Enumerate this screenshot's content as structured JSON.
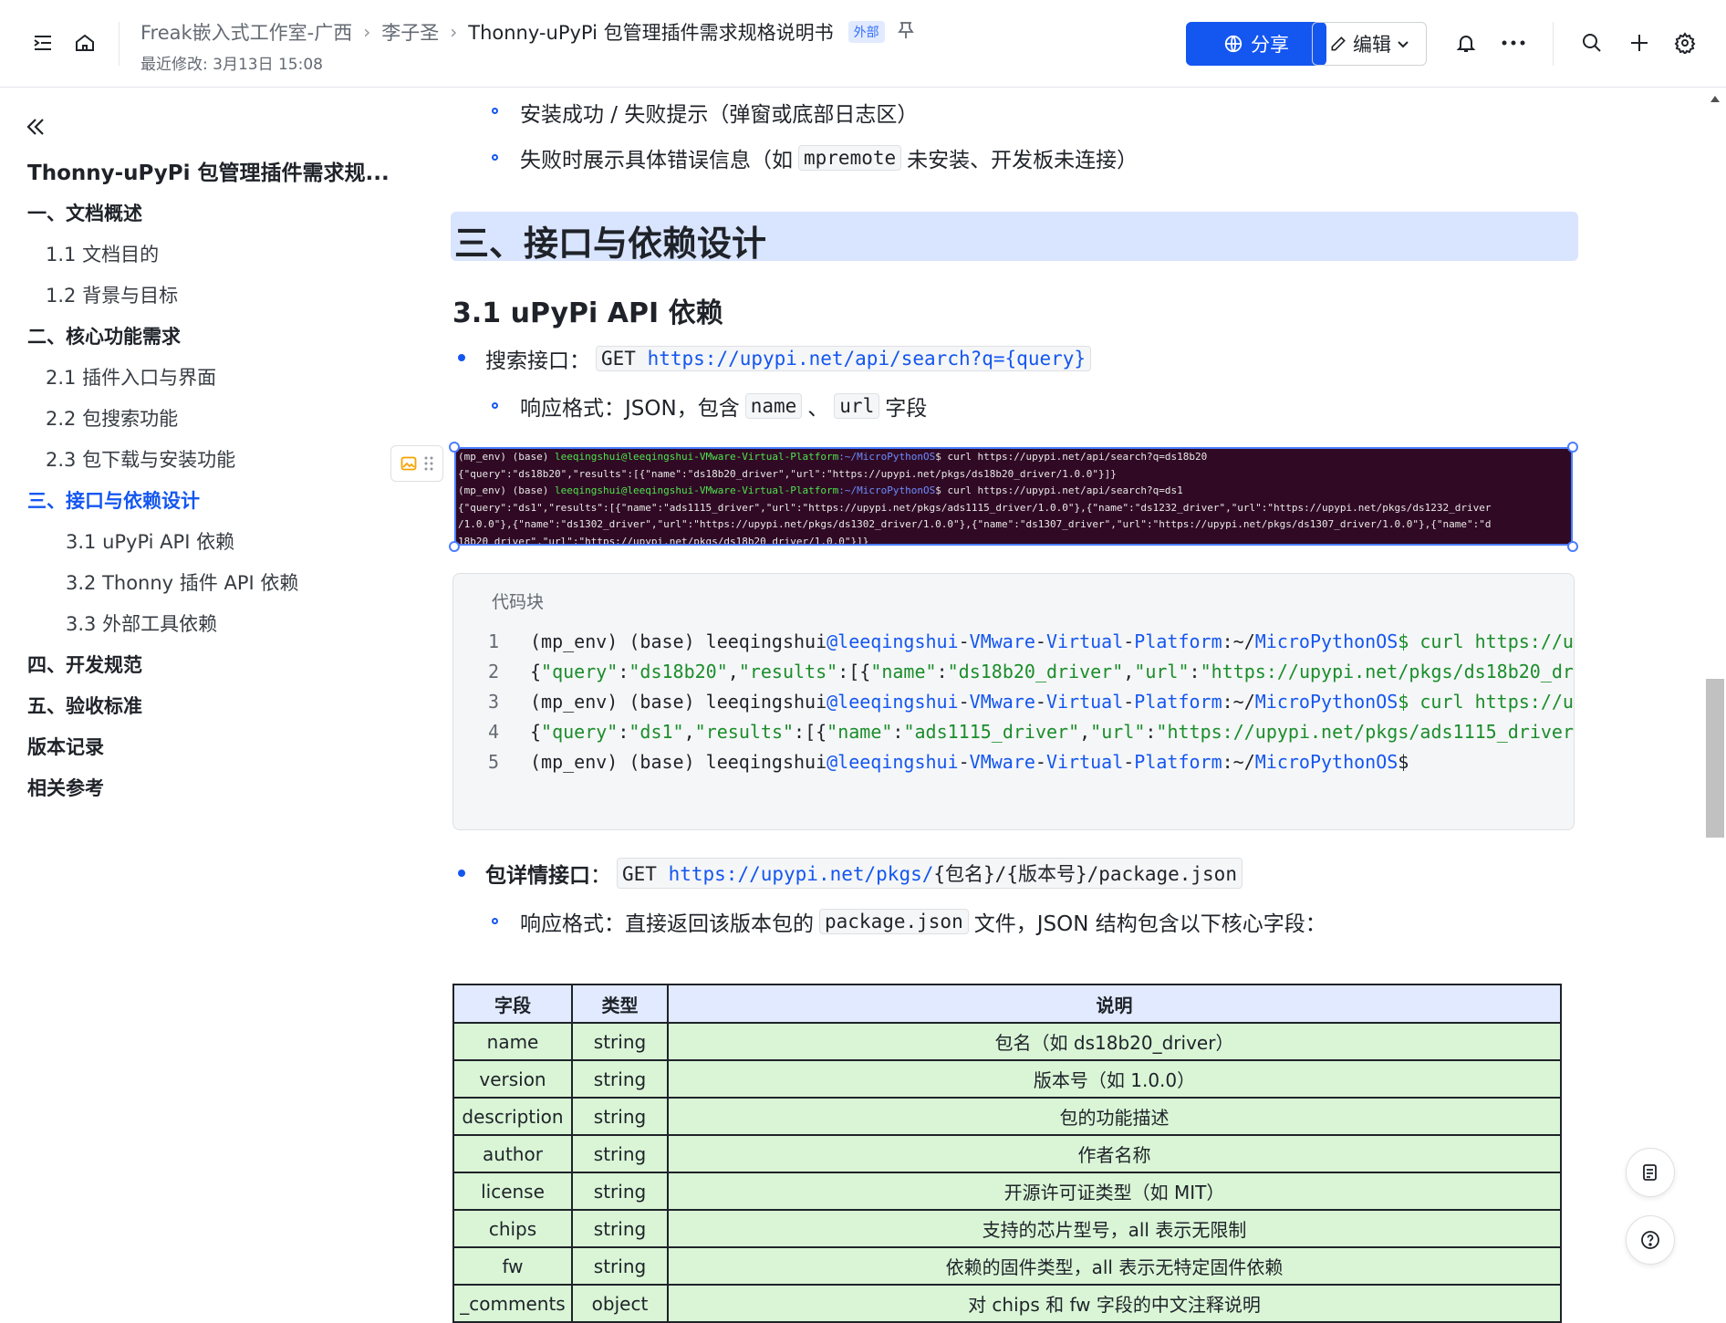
{
  "header": {
    "breadcrumbs": [
      "Freak嵌入式工作室-广西",
      "李子圣",
      "Thonny-uPyPi 包管理插件需求规格说明书"
    ],
    "badge": "外部",
    "modified": "最近修改: 3月13日 15:08",
    "share_label": "分享",
    "edit_label": "编辑"
  },
  "sidebar": {
    "doc_title": "Thonny-uPyPi 包管理插件需求规...",
    "toc": [
      {
        "label": "一、文档概述",
        "level": 1
      },
      {
        "label": "1.1 文档目的",
        "level": 2
      },
      {
        "label": "1.2 背景与目标",
        "level": 2
      },
      {
        "label": "二、核心功能需求",
        "level": 1
      },
      {
        "label": "2.1 插件入口与界面",
        "level": 2
      },
      {
        "label": "2.2 包搜索功能",
        "level": 2
      },
      {
        "label": "2.3 包下载与安装功能",
        "level": 2
      },
      {
        "label": "三、接口与依赖设计",
        "level": 1,
        "active": true
      },
      {
        "label": "3.1 uPyPi API 依赖",
        "level": 3
      },
      {
        "label": "3.2 Thonny 插件 API 依赖",
        "level": 3
      },
      {
        "label": "3.3 外部工具依赖",
        "level": 3
      },
      {
        "label": "四、开发规范",
        "level": 1
      },
      {
        "label": "五、验收标准",
        "level": 1
      },
      {
        "label": "版本记录",
        "level": 1
      },
      {
        "label": "相关参考",
        "level": 1
      }
    ]
  },
  "content": {
    "b1": "安装成功 / 失败提示（弹窗或底部日志区）",
    "b2_pre": "失败时展示具体错误信息（如",
    "b2_code": "mpremote",
    "b2_post": "未安装、开发板未连接）",
    "h1": "三、接口与依赖设计",
    "h2": "3.1 uPyPi API 依赖",
    "search_label": "搜索接口：",
    "search_method": "GET",
    "search_url": "https://upypi.net/api/search?q={query}",
    "resp_pre": "响应格式：JSON，包含",
    "resp_code1": "name",
    "resp_sep": "、",
    "resp_code2": "url",
    "resp_post": "字段",
    "terminal": {
      "l1_prompt": "(mp_env) (base) ",
      "l1_user": "leeqingshui@leeqingshui-VMware-Virtual-Platform",
      "l1_path": ":~/MicroPythonOS",
      "l1_cmd": "$ curl https://upypi.net/api/search?q=ds18b20",
      "l2": "{\"query\":\"ds18b20\",\"results\":[{\"name\":\"ds18b20_driver\",\"url\":\"https://upypi.net/pkgs/ds18b20_driver/1.0.0\"}]}",
      "l3_cmd": "$ curl https://upypi.net/api/search?q=ds1",
      "l4": "{\"query\":\"ds1\",\"results\":[{\"name\":\"ads1115_driver\",\"url\":\"https://upypi.net/pkgs/ads1115_driver/1.0.0\"},{\"name\":\"ds1232_driver\",\"url\":\"https://upypi.net/pkgs/ds1232_driver",
      "l5": "/1.0.0\"},{\"name\":\"ds1302_driver\",\"url\":\"https://upypi.net/pkgs/ds1302_driver/1.0.0\"},{\"name\":\"ds1307_driver\",\"url\":\"https://upypi.net/pkgs/ds1307_driver/1.0.0\"},{\"name\":\"d",
      "l6": "18b20_driver\",\"url\":\"https://upypi.net/pkgs/ds18b20_driver/1.0.0\"}]}"
    },
    "codeblock": {
      "label": "代码块",
      "nums": [
        "1",
        "2",
        "3",
        "4",
        "5"
      ],
      "prompt": "(mp_env) (base) leeqingshui",
      "host1": "@leeqingshui",
      "dash": "-",
      "vm": "VMware",
      "virt": "Virtual",
      "plat": "Platform",
      "colon_tilde": ":~/",
      "mpos": "MicroPythonOS",
      "curl": "$ curl https://u",
      "dollar": "$",
      "l2": [
        "{",
        "\"query\"",
        ":",
        "\"ds18b20\"",
        ",",
        "\"results\"",
        ":[{",
        "\"name\"",
        ":",
        "\"ds18b20_driver\"",
        ",",
        "\"url\"",
        ":",
        "\"https://upypi.net/pkgs/ds18b20_dr"
      ],
      "l4": [
        "{",
        "\"query\"",
        ":",
        "\"ds1\"",
        ",",
        "\"results\"",
        ":[{",
        "\"name\"",
        ":",
        "\"ads1115_driver\"",
        ",",
        "\"url\"",
        ":",
        "\"https://upypi.net/pkgs/ads1115_driver/"
      ]
    },
    "detail_label": "包详情接口",
    "detail_colon": "：",
    "detail_method": "GET",
    "detail_url": "https://upypi.net/pkgs/",
    "detail_tail": "{包名}/{版本号}/package.json",
    "detail_resp_pre": "响应格式：直接返回该版本包的",
    "detail_resp_code": "package.json",
    "detail_resp_post": "文件，JSON 结构包含以下核心字段："
  },
  "table": {
    "headers": [
      "字段",
      "类型",
      "说明"
    ],
    "rows": [
      [
        "name",
        "string",
        "包名（如 ds18b20_driver）"
      ],
      [
        "version",
        "string",
        "版本号（如 1.0.0）"
      ],
      [
        "description",
        "string",
        "包的功能描述"
      ],
      [
        "author",
        "string",
        "作者名称"
      ],
      [
        "license",
        "string",
        "开源许可证类型（如 MIT）"
      ],
      [
        "chips",
        "string",
        "支持的芯片型号，all 表示无限制"
      ],
      [
        "fw",
        "string",
        "依赖的固件类型，all 表示无特定固件依赖"
      ],
      [
        "_comments",
        "object",
        "对 chips 和 fw 字段的中文注释说明"
      ]
    ]
  },
  "colors": {
    "accent": "#1456f0",
    "h1_bg": "#d9e4ff",
    "table_header": "#e1eaff",
    "table_cell": "#d9f5d6",
    "terminal_bg": "#300a24"
  }
}
